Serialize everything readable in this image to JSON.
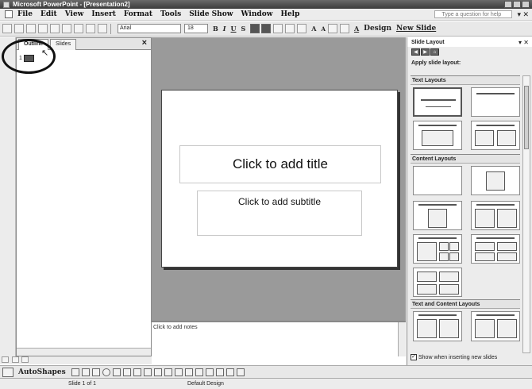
{
  "window": {
    "title": "Microsoft PowerPoint - [Presentation2]"
  },
  "menu": {
    "items": [
      "File",
      "Edit",
      "View",
      "Insert",
      "Format",
      "Tools",
      "Slide Show",
      "Window",
      "Help"
    ],
    "ask_placeholder": "Type a question for help"
  },
  "toolbar": {
    "font": "Arial",
    "size": "18",
    "bold": "B",
    "italic": "I",
    "underline": "U",
    "shadow": "S",
    "grow": "A",
    "shrink": "A",
    "font_color": "A",
    "design_label": "Design",
    "new_slide_label": "New Slide"
  },
  "left_pane": {
    "tabs": [
      "Outline",
      "Slides"
    ],
    "close_label": "×",
    "slide_number": "1"
  },
  "slide": {
    "title_placeholder": "Click to add title",
    "subtitle_placeholder": "Click to add subtitle"
  },
  "notes": {
    "placeholder": "Click to add notes"
  },
  "task_pane": {
    "title": "Slide Layout",
    "apply_label": "Apply slide layout:",
    "sections": [
      "Text Layouts",
      "Content Layouts",
      "Text and Content Layouts"
    ],
    "footer_checkbox": "Show when inserting new slides"
  },
  "drawing": {
    "autoshapes_label": "AutoShapes"
  },
  "status": {
    "slide_info": "Slide 1 of 1",
    "design": "Default Design"
  },
  "colors": {
    "workspace": "#9a9a9a",
    "toolbar": "#e8e8e8",
    "annotation": "#111111"
  }
}
